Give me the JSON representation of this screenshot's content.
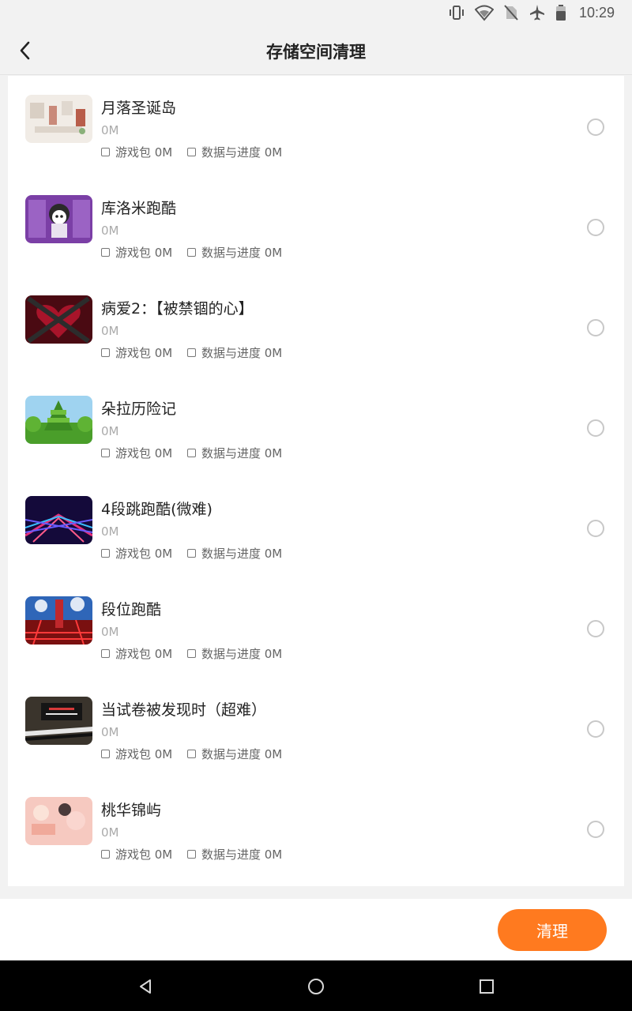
{
  "status_bar": {
    "time": "10:29",
    "icons": [
      "vibrate-icon",
      "wifi-icon",
      "no-sim-icon",
      "airplane-icon",
      "battery-icon"
    ]
  },
  "header": {
    "title": "存储空间清理",
    "back_icon": "chevron-left-icon"
  },
  "list": {
    "option_package_label": "游戏包 0M",
    "option_data_label": "数据与进度 0M",
    "items": [
      {
        "title": "",
        "size": "0M"
      },
      {
        "title": "月落圣诞岛",
        "size": "0M"
      },
      {
        "title": "库洛米跑酷",
        "size": "0M"
      },
      {
        "title": "病爱2：【被禁锢的心】",
        "size": "0M"
      },
      {
        "title": "朵拉历险记",
        "size": "0M"
      },
      {
        "title": "4段跳跑酷(微难)",
        "size": "0M"
      },
      {
        "title": "段位跑酷",
        "size": "0M"
      },
      {
        "title": "当试卷被发现时（超难）",
        "size": "0M"
      },
      {
        "title": "桃华锦屿",
        "size": "0M"
      }
    ]
  },
  "footer": {
    "clean_label": "清理"
  },
  "colors": {
    "accent": "#ff7a1f",
    "background": "#f2f2f2",
    "card": "#ffffff"
  }
}
